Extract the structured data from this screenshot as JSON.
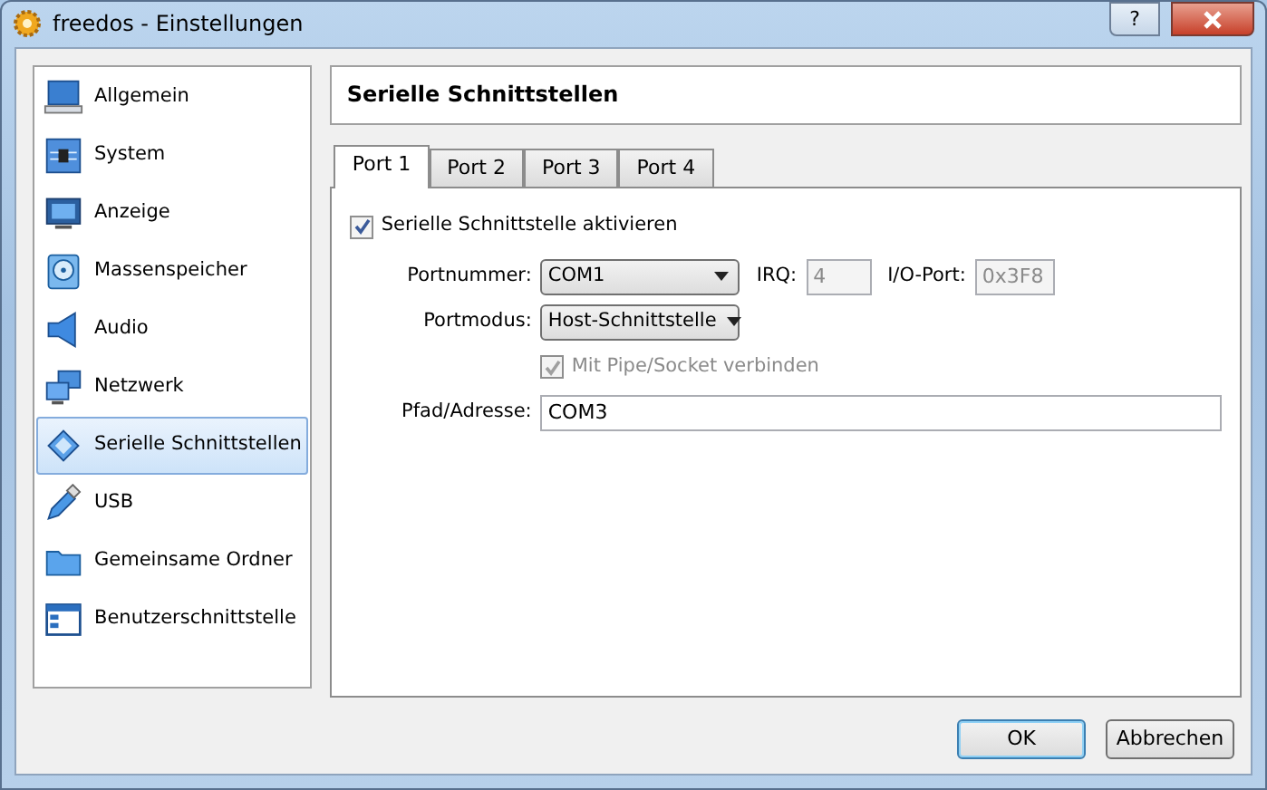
{
  "window": {
    "title": "freedos - Einstellungen",
    "help": "?"
  },
  "sidebar": {
    "items": [
      {
        "label": "Allgemein",
        "selected": false
      },
      {
        "label": "System",
        "selected": false
      },
      {
        "label": "Anzeige",
        "selected": false
      },
      {
        "label": "Massenspeicher",
        "selected": false
      },
      {
        "label": "Audio",
        "selected": false
      },
      {
        "label": "Netzwerk",
        "selected": false
      },
      {
        "label": "Serielle Schnittstellen",
        "selected": true
      },
      {
        "label": "USB",
        "selected": false
      },
      {
        "label": "Gemeinsame Ordner",
        "selected": false
      },
      {
        "label": "Benutzerschnittstelle",
        "selected": false
      }
    ]
  },
  "page_title": "Serielle Schnittstellen",
  "tabs": [
    {
      "label": "Port 1",
      "selected": true
    },
    {
      "label": "Port 2",
      "selected": false
    },
    {
      "label": "Port 3",
      "selected": false
    },
    {
      "label": "Port 4",
      "selected": false
    }
  ],
  "enable": {
    "label": "Serielle Schnittstelle aktivieren",
    "checked": true
  },
  "port_number": {
    "label": "Portnummer:",
    "value": "COM1"
  },
  "irq": {
    "label": "IRQ:",
    "value": "4",
    "disabled": true
  },
  "io_port": {
    "label": "I/O-Port:",
    "value": "0x3F8",
    "disabled": true
  },
  "port_mode": {
    "label": "Portmodus:",
    "value": "Host-Schnittstelle"
  },
  "pipe": {
    "label": "Mit Pipe/Socket verbinden",
    "checked": true,
    "disabled": true
  },
  "path": {
    "label": "Pfad/Adresse:",
    "value": "COM3"
  },
  "buttons": [
    {
      "label": "OK",
      "kind": "default"
    },
    {
      "label": "Abbrechen",
      "kind": "normal"
    }
  ]
}
